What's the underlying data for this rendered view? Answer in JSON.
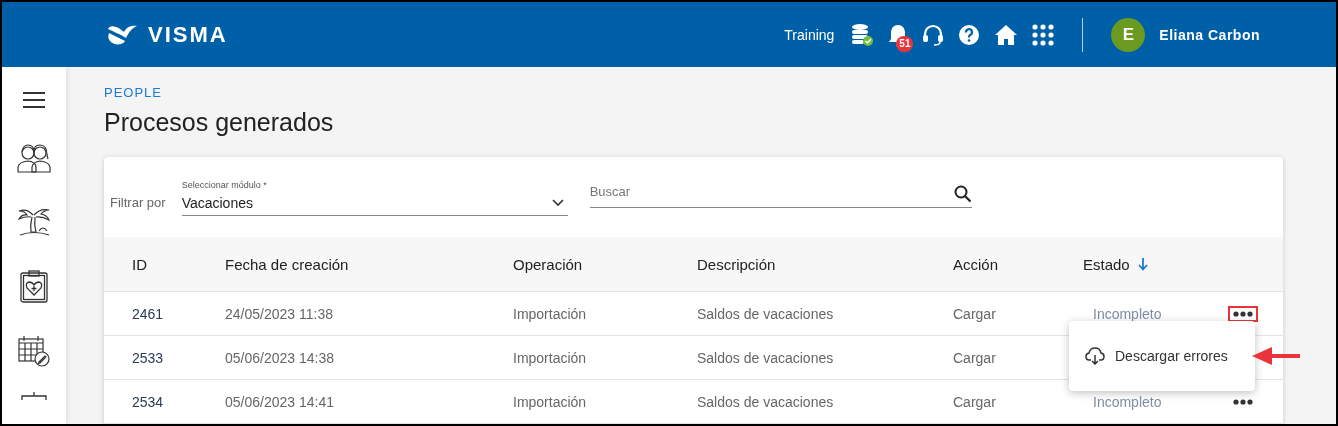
{
  "header": {
    "logo": "VISMA",
    "environment": "Training",
    "notifications_count": "51",
    "user": {
      "initial": "E",
      "name": "Eliana Carbon"
    }
  },
  "breadcrumb": "PEOPLE",
  "title": "Procesos generados",
  "filter": {
    "label": "Filtrar por",
    "module_label": "Seleccionar módulo *",
    "module_value": "Vacaciones",
    "search_placeholder": "Buscar"
  },
  "table": {
    "columns": [
      {
        "label": "ID",
        "sorted": false
      },
      {
        "label": "Fecha de creación",
        "sorted": false
      },
      {
        "label": "Operación",
        "sorted": false
      },
      {
        "label": "Descripción",
        "sorted": false
      },
      {
        "label": "Acción",
        "sorted": false
      },
      {
        "label": "Estado",
        "sorted": true
      }
    ],
    "rows": [
      {
        "cells": [
          "2461",
          "24/05/2023 11:38",
          "Importación",
          "Saldos de vacaciones",
          "Cargar",
          "Incompleto"
        ],
        "more_button": true,
        "highlighted": true
      },
      {
        "cells": [
          "2533",
          "05/06/2023 14:38",
          "Importación",
          "Saldos de vacaciones",
          "Cargar"
        ]
      },
      {
        "cells": [
          "2534",
          "05/06/2023 14:41",
          "Importación",
          "Saldos de vacaciones",
          "Cargar",
          "Incompleto"
        ],
        "more_button": true,
        "highlighted": false
      }
    ]
  },
  "context_menu": {
    "items": [
      {
        "label": "Descargar errores",
        "highlighted": true
      }
    ]
  }
}
